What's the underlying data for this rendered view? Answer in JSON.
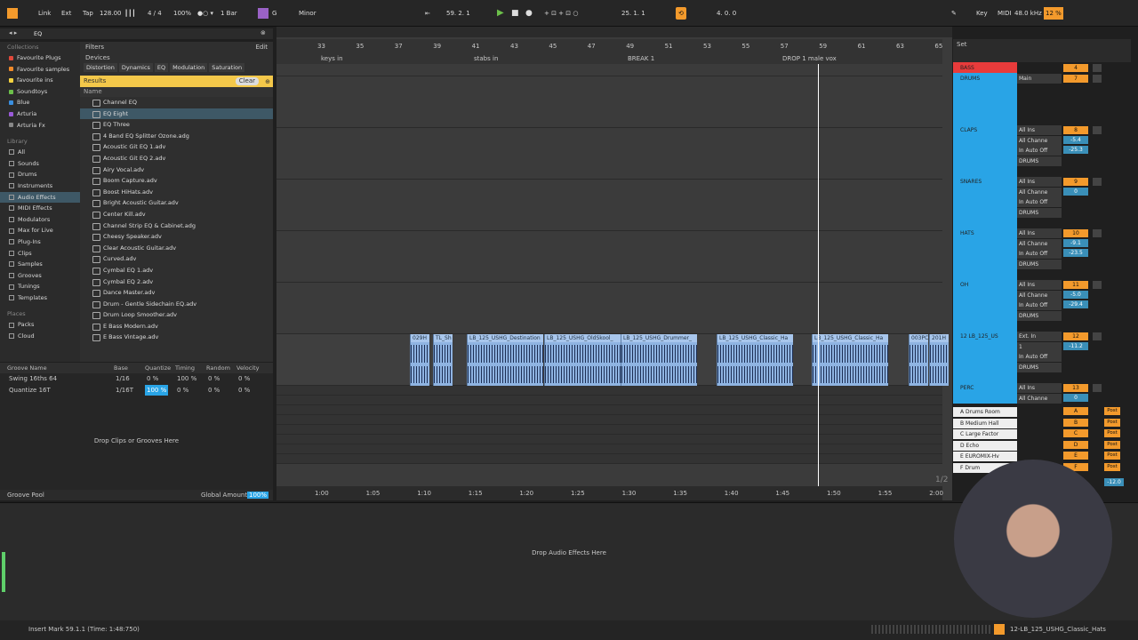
{
  "transport": {
    "link": "Link",
    "ext": "Ext",
    "tap": "Tap",
    "tempo": "128.00",
    "sig": "4 / 4",
    "zoom": "100%",
    "quant": "1 Bar",
    "key": "G",
    "scale": "Minor",
    "position": "59.  2.  1",
    "loop_start": "25.  1.  1",
    "loop_len": "4.  0.  0",
    "key_label": "Key",
    "midi_label": "MIDI",
    "sample_rate": "48.0 kHz",
    "cpu": "12 %"
  },
  "sidebar": {
    "search_value": "EQ",
    "collections_header": "Collections",
    "collections": [
      {
        "label": "Favourite Plugs",
        "color": "#e0493b"
      },
      {
        "label": "Favourite samples",
        "color": "#f08a2a"
      },
      {
        "label": "favourite ins",
        "color": "#f3d240"
      },
      {
        "label": "Soundtoys",
        "color": "#6cc04a"
      },
      {
        "label": "Blue",
        "color": "#3a8fe0"
      },
      {
        "label": "Arturia",
        "color": "#9a5ad8"
      },
      {
        "label": "Arturia Fx",
        "color": "#888888"
      }
    ],
    "library_header": "Library",
    "library": [
      "All",
      "Sounds",
      "Drums",
      "Instruments",
      "Audio Effects",
      "MIDI Effects",
      "Modulators",
      "Max for Live",
      "Plug-Ins",
      "Clips",
      "Samples",
      "Grooves",
      "Tunings",
      "Templates"
    ],
    "places_header": "Places",
    "places": [
      "Packs",
      "Cloud"
    ]
  },
  "browser": {
    "filters": "Filters",
    "edit": "Edit",
    "devices": "Devices",
    "chips": [
      "Distortion",
      "Dynamics",
      "EQ",
      "Modulation",
      "Saturation"
    ],
    "results": "Results",
    "clear": "Clear",
    "name_col": "Name",
    "items": [
      "Channel EQ",
      "EQ Eight",
      "EQ Three",
      "4 Band EQ  Splitter Ozone.adg",
      "Acoustic Git EQ 1.adv",
      "Acoustic Git EQ 2.adv",
      "Airy Vocal.adv",
      "Boom Capture.adv",
      "Boost HiHats.adv",
      "Bright Acoustic Guitar.adv",
      "Center Kill.adv",
      "Channel Strip EQ & Cabinet.adg",
      "Cheesy Speaker.adv",
      "Clear Acoustic Guitar.adv",
      "Curved.adv",
      "Cymbal EQ 1.adv",
      "Cymbal EQ 2.adv",
      "Dance Master.adv",
      "Drum - Gentle Sidechain EQ.adv",
      "Drum Loop Smoother.adv",
      "E Bass Modern.adv",
      "E Bass Vintage.adv"
    ]
  },
  "groove_pool": {
    "headers": [
      "Groove Name",
      "Base",
      "Quantize",
      "Timing",
      "Random",
      "Velocity"
    ],
    "rows": [
      {
        "name": "Swing 16ths 64",
        "base": "1/16",
        "quantize": "0 %",
        "timing": "100 %",
        "random": "0 %",
        "velocity": "0 %"
      },
      {
        "name": "Quantize 16T",
        "base": "1/16T",
        "quantize": "100 %",
        "timing": "0 %",
        "random": "0 %",
        "velocity": "0 %"
      }
    ],
    "drop": "Drop Clips or Grooves Here",
    "footer": "Groove Pool",
    "global_label": "Global Amount",
    "global_value": "100%"
  },
  "arrangement": {
    "bars": [
      "33",
      "35",
      "37",
      "39",
      "41",
      "43",
      "45",
      "47",
      "49",
      "51",
      "53",
      "55",
      "57",
      "59",
      "61",
      "63",
      "65"
    ],
    "locators": [
      "keys in",
      "stabs in",
      "BREAK 1",
      "DROP 1 male vox"
    ],
    "times": [
      "1:00",
      "1:05",
      "1:10",
      "1:15",
      "1:20",
      "1:25",
      "1:30",
      "1:35",
      "1:40",
      "1:45",
      "1:50",
      "1:55",
      "2:00"
    ],
    "clips": [
      "029H",
      "TL_Sh",
      "LB_125_USHG_Destination",
      "LB_125_USHG_OldSkool_",
      "LB_125_USHG_Drummer_",
      "LB_125_USHG_Classic_Ha",
      "LB_125_USHG_Classic_Ha",
      "003PC",
      "201H"
    ],
    "page": "1/2"
  },
  "mixer": {
    "set": "Set",
    "tracks": [
      {
        "name": "BASS",
        "num": "4"
      },
      {
        "name": "DRUMS",
        "num": "7",
        "io": [
          "Main"
        ]
      },
      {
        "name": "CLAPS",
        "num": "8",
        "io": [
          "All Ins",
          "All Channe",
          "In Auto Off",
          "DRUMS"
        ],
        "vol": "-5.4",
        "pan": "-25.3"
      },
      {
        "name": "SNARES",
        "num": "9",
        "io": [
          "All Ins",
          "All Channe",
          "In Auto Off",
          "DRUMS"
        ],
        "vol": "0"
      },
      {
        "name": "HATS",
        "num": "10",
        "io": [
          "All Ins",
          "All Channe",
          "In Auto Off",
          "DRUMS"
        ],
        "vol": "-9.1",
        "pan": "-23.5"
      },
      {
        "name": "OH",
        "num": "11",
        "io": [
          "All Ins",
          "All Channe",
          "In Auto Off",
          "DRUMS"
        ],
        "vol": "-5.0",
        "pan": "-29.4"
      },
      {
        "name": "12 LB_125_US",
        "num": "12",
        "io": [
          "Ext. In",
          "1",
          "In Auto Off",
          "DRUMS"
        ],
        "vol": "-11.2"
      },
      {
        "name": "PERC",
        "num": "13",
        "io": [
          "All Ins",
          "All Channe"
        ],
        "vol": "0"
      }
    ],
    "returns": [
      {
        "name": "A Drums Room",
        "letter": "A"
      },
      {
        "name": "B Medium Hall",
        "letter": "B"
      },
      {
        "name": "C Large Factor",
        "letter": "C"
      },
      {
        "name": "D Echo",
        "letter": "D"
      },
      {
        "name": "E EUROMIX-Hv",
        "letter": "E"
      },
      {
        "name": "F Drum",
        "letter": "F"
      }
    ],
    "post": "Post",
    "master_vol": "-12.0"
  },
  "device_area": {
    "drop": "Drop Audio Effects Here"
  },
  "status": {
    "left": "Insert Mark 59.1.1 (Time: 1:48:750)",
    "right": "12-LB_125_USHG_Classic_Hats"
  }
}
